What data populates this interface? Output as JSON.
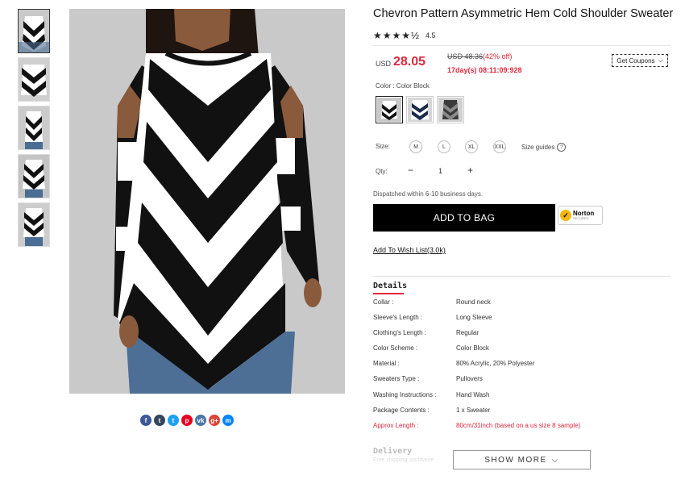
{
  "gallery": {
    "thumbnails": [
      {
        "alt": "thumbnail-1",
        "selected": true
      },
      {
        "alt": "thumbnail-2",
        "selected": false
      },
      {
        "alt": "thumbnail-3",
        "selected": false
      },
      {
        "alt": "thumbnail-4",
        "selected": false
      },
      {
        "alt": "thumbnail-5",
        "selected": false
      }
    ]
  },
  "share": {
    "icons": [
      {
        "name": "facebook-icon",
        "glyph": "f",
        "color": "#3b5998"
      },
      {
        "name": "tumblr-icon",
        "glyph": "t",
        "color": "#35465c"
      },
      {
        "name": "twitter-icon",
        "glyph": "t",
        "color": "#1da1f2"
      },
      {
        "name": "pinterest-icon",
        "glyph": "p",
        "color": "#e60023"
      },
      {
        "name": "vk-icon",
        "glyph": "vk",
        "color": "#4a76a8"
      },
      {
        "name": "google-plus-icon",
        "glyph": "g+",
        "color": "#db4437"
      },
      {
        "name": "messenger-icon",
        "glyph": "m",
        "color": "#0084ff"
      }
    ]
  },
  "product": {
    "title": "Chevron Pattern Asymmetric Hem Cold Shoulder Sweater",
    "rating_stars": "★★★★½",
    "rating_value": "4.5",
    "currency": "USD",
    "price": "28.05",
    "old_price": "USD 48.36",
    "discount": "(42% off)",
    "countdown": "17day(s) 08:11:09:928",
    "coupon_label": "Get Coupons",
    "color_label": "Color : Color Block",
    "size_label": "Size:",
    "sizes": [
      "M",
      "L",
      "XL",
      "XXL"
    ],
    "size_guide": "Size guides",
    "qty_label": "Qty:",
    "qty_minus": "−",
    "qty_value": "1",
    "qty_plus": "+",
    "dispatch": "Dispatched within 6-10 business days.",
    "add_to_bag": "ADD TO BAG",
    "norton_brand": "Norton",
    "norton_sub": "SECURED",
    "wishlist": "Add To Wish List(3.0k)"
  },
  "details": {
    "title": "Details",
    "specs": [
      {
        "key": "Collar :",
        "value": "Round neck"
      },
      {
        "key": "Sleeve's Length :",
        "value": "Long Sleeve"
      },
      {
        "key": "Clothing's Length :",
        "value": "Regular"
      },
      {
        "key": "Color Scheme :",
        "value": "Color Block"
      },
      {
        "key": "Material :",
        "value": "80% Acrylic, 20% Polyester"
      },
      {
        "key": "Sweaters Type :",
        "value": "Pullovers"
      },
      {
        "key": "Washing Instructions :",
        "value": "Hand Wash"
      },
      {
        "key": "Package Contents :",
        "value": "1 x Sweater"
      },
      {
        "key": "Approx Length :",
        "value": "80cm/31inch (based on a us size 8 sample)"
      }
    ]
  },
  "delivery": {
    "title": "Delivery",
    "faded_text": "Free shipping worldwide"
  },
  "show_more": "SHOW MORE",
  "colors": {
    "accent": "#e0283d",
    "button": "#000000"
  }
}
